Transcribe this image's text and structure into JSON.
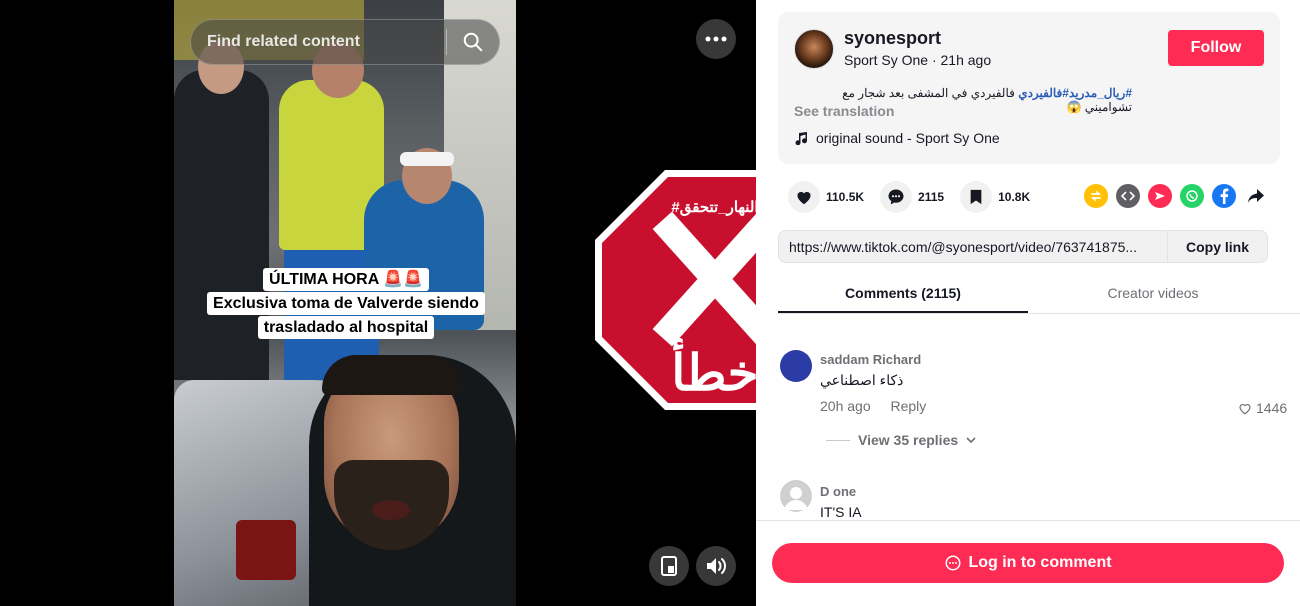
{
  "video": {
    "search_placeholder": "Find related content",
    "caption_lines": [
      "ÚLTIMA HORA 🚨🚨",
      "Exclusiva toma de Valverde siendo",
      "trasladado al hospital"
    ]
  },
  "overlay": {
    "tag": "#النهار_تتحقق",
    "verdict": "خطأ",
    "color": "#c8102e"
  },
  "author": {
    "username": "syonesport",
    "display_name": "Sport Sy One",
    "time": "21h ago",
    "follow_label": "Follow"
  },
  "post": {
    "hashtags": [
      "#ريال_مدريد",
      "#فالفيردي"
    ],
    "text": "فالفيردي في المشفى بعد شجار مع تشواميني 😱",
    "see_translation": "See translation",
    "sound": "original sound - Sport Sy One"
  },
  "stats": {
    "likes": "110.5K",
    "comments": "2115",
    "saves": "10.8K"
  },
  "share": {
    "icons": [
      "repost-icon",
      "embed-icon",
      "send-icon",
      "whatsapp-icon",
      "facebook-icon",
      "share-arrow-icon"
    ]
  },
  "link": {
    "url": "https://www.tiktok.com/@syonesport/video/763741875...",
    "copy_label": "Copy link"
  },
  "tabs": [
    {
      "label": "Comments (2115)",
      "active": true
    },
    {
      "label": "Creator videos",
      "active": false
    }
  ],
  "comments": [
    {
      "name": "saddam Richard",
      "text": "ذكاء اصطناعي",
      "time": "20h ago",
      "reply_label": "Reply",
      "likes": "1446",
      "view_replies": "View 35 replies"
    },
    {
      "name": "D one",
      "text": "IT'S IA"
    }
  ],
  "comment_bar": {
    "login_label": "Log in to comment"
  },
  "colors": {
    "brand": "#fe2c55",
    "hashtag": "#2b5db9"
  }
}
